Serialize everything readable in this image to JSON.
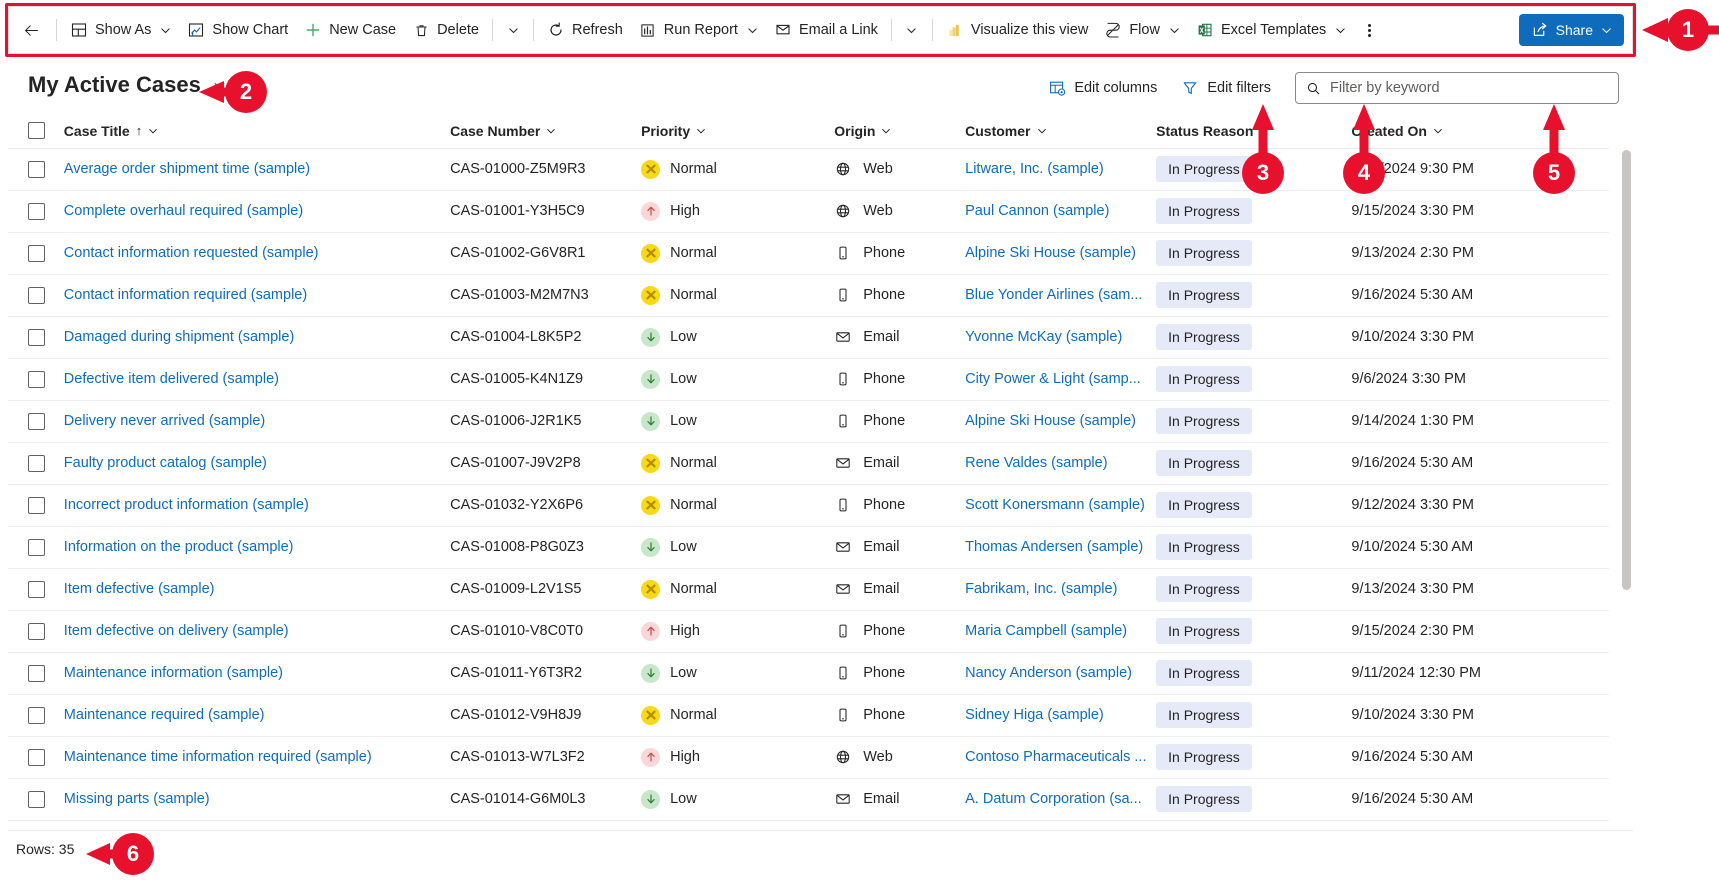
{
  "command_bar": {
    "back_label": "Back",
    "items": [
      {
        "id": "show-as",
        "label": "Show As",
        "icon": "show-as-icon",
        "caret": true
      },
      {
        "id": "show-chart",
        "label": "Show Chart",
        "icon": "chart-icon",
        "caret": false
      },
      {
        "id": "new-case",
        "label": "New Case",
        "icon": "plus-icon",
        "caret": false
      },
      {
        "id": "delete",
        "label": "Delete",
        "icon": "trash-icon",
        "caret": false
      },
      {
        "id": "delete-more",
        "label": "",
        "icon": "chevron-down-icon",
        "caret": true
      },
      {
        "id": "refresh",
        "label": "Refresh",
        "icon": "refresh-icon",
        "caret": false
      },
      {
        "id": "run-report",
        "label": "Run Report",
        "icon": "report-icon",
        "caret": true
      },
      {
        "id": "email-a-link",
        "label": "Email a Link",
        "icon": "email-link-icon",
        "caret": false
      },
      {
        "id": "email-more",
        "label": "",
        "icon": "chevron-down-icon",
        "caret": true
      },
      {
        "id": "visualize-this-view",
        "label": "Visualize this view",
        "icon": "powerbi-icon",
        "caret": false
      },
      {
        "id": "flow",
        "label": "Flow",
        "icon": "flow-icon",
        "caret": true
      },
      {
        "id": "excel-templates",
        "label": "Excel Templates",
        "icon": "excel-icon",
        "caret": true
      }
    ],
    "overflow_label": "More commands",
    "share": {
      "label": "Share",
      "icon": "share-icon",
      "caret": true,
      "color": "#0f6cbd"
    }
  },
  "view": {
    "title": "My Active Cases",
    "title_caret": "chevron-down-icon"
  },
  "grid_actions": {
    "edit_columns": {
      "label": "Edit columns",
      "icon": "edit-columns-icon"
    },
    "edit_filters": {
      "label": "Edit filters",
      "icon": "filter-icon"
    },
    "search": {
      "placeholder": "Filter by keyword",
      "value": "",
      "icon": "search-icon"
    }
  },
  "table": {
    "select_all_label": "Select all rows",
    "columns": [
      {
        "key": "title",
        "label": "Case Title",
        "sorted": "asc",
        "sort_glyph": "↑"
      },
      {
        "key": "casenumber",
        "label": "Case Number"
      },
      {
        "key": "priority",
        "label": "Priority"
      },
      {
        "key": "origin",
        "label": "Origin"
      },
      {
        "key": "customer",
        "label": "Customer"
      },
      {
        "key": "status",
        "label": "Status Reason"
      },
      {
        "key": "created",
        "label": "Created On"
      }
    ],
    "rows": [
      {
        "title": "Average order shipment time (sample)",
        "casenumber": "CAS-01000-Z5M9R3",
        "priority": "Normal",
        "priority_level": "normal",
        "origin": "Web",
        "origin_icon": "globe-icon",
        "customer": "Litware, Inc. (sample)",
        "status": "In Progress",
        "created": "9/15/2024 9:30 PM"
      },
      {
        "title": "Complete overhaul required (sample)",
        "casenumber": "CAS-01001-Y3H5C9",
        "priority": "High",
        "priority_level": "high",
        "origin": "Web",
        "origin_icon": "globe-icon",
        "customer": "Paul Cannon (sample)",
        "status": "In Progress",
        "created": "9/15/2024 3:30 PM"
      },
      {
        "title": "Contact information requested (sample)",
        "casenumber": "CAS-01002-G6V8R1",
        "priority": "Normal",
        "priority_level": "normal",
        "origin": "Phone",
        "origin_icon": "phone-icon",
        "customer": "Alpine Ski House (sample)",
        "status": "In Progress",
        "created": "9/13/2024 2:30 PM"
      },
      {
        "title": "Contact information required (sample)",
        "casenumber": "CAS-01003-M2M7N3",
        "priority": "Normal",
        "priority_level": "normal",
        "origin": "Phone",
        "origin_icon": "phone-icon",
        "customer": "Blue Yonder Airlines (sam...",
        "status": "In Progress",
        "created": "9/16/2024 5:30 AM"
      },
      {
        "title": "Damaged during shipment (sample)",
        "casenumber": "CAS-01004-L8K5P2",
        "priority": "Low",
        "priority_level": "low",
        "origin": "Email",
        "origin_icon": "envelope-icon",
        "customer": "Yvonne McKay (sample)",
        "status": "In Progress",
        "created": "9/10/2024 3:30 PM"
      },
      {
        "title": "Defective item delivered (sample)",
        "casenumber": "CAS-01005-K4N1Z9",
        "priority": "Low",
        "priority_level": "low",
        "origin": "Phone",
        "origin_icon": "phone-icon",
        "customer": "City Power & Light (samp...",
        "status": "In Progress",
        "created": "9/6/2024 3:30 PM"
      },
      {
        "title": "Delivery never arrived (sample)",
        "casenumber": "CAS-01006-J2R1K5",
        "priority": "Low",
        "priority_level": "low",
        "origin": "Phone",
        "origin_icon": "phone-icon",
        "customer": "Alpine Ski House (sample)",
        "status": "In Progress",
        "created": "9/14/2024 1:30 PM"
      },
      {
        "title": "Faulty product catalog (sample)",
        "casenumber": "CAS-01007-J9V2P8",
        "priority": "Normal",
        "priority_level": "normal",
        "origin": "Email",
        "origin_icon": "envelope-icon",
        "customer": "Rene Valdes (sample)",
        "status": "In Progress",
        "created": "9/16/2024 5:30 AM"
      },
      {
        "title": "Incorrect product information (sample)",
        "casenumber": "CAS-01032-Y2X6P6",
        "priority": "Normal",
        "priority_level": "normal",
        "origin": "Phone",
        "origin_icon": "phone-icon",
        "customer": "Scott Konersmann (sample)",
        "status": "In Progress",
        "created": "9/12/2024 3:30 PM"
      },
      {
        "title": "Information on the product (sample)",
        "casenumber": "CAS-01008-P8G0Z3",
        "priority": "Low",
        "priority_level": "low",
        "origin": "Email",
        "origin_icon": "envelope-icon",
        "customer": "Thomas Andersen (sample)",
        "status": "In Progress",
        "created": "9/10/2024 5:30 AM"
      },
      {
        "title": "Item defective (sample)",
        "casenumber": "CAS-01009-L2V1S5",
        "priority": "Normal",
        "priority_level": "normal",
        "origin": "Email",
        "origin_icon": "envelope-icon",
        "customer": "Fabrikam, Inc. (sample)",
        "status": "In Progress",
        "created": "9/13/2024 3:30 PM"
      },
      {
        "title": "Item defective on delivery (sample)",
        "casenumber": "CAS-01010-V8C0T0",
        "priority": "High",
        "priority_level": "high",
        "origin": "Phone",
        "origin_icon": "phone-icon",
        "customer": "Maria Campbell (sample)",
        "status": "In Progress",
        "created": "9/15/2024 2:30 PM"
      },
      {
        "title": "Maintenance information (sample)",
        "casenumber": "CAS-01011-Y6T3R2",
        "priority": "Low",
        "priority_level": "low",
        "origin": "Phone",
        "origin_icon": "phone-icon",
        "customer": "Nancy Anderson (sample)",
        "status": "In Progress",
        "created": "9/11/2024 12:30 PM"
      },
      {
        "title": "Maintenance required (sample)",
        "casenumber": "CAS-01012-V9H8J9",
        "priority": "Normal",
        "priority_level": "normal",
        "origin": "Phone",
        "origin_icon": "phone-icon",
        "customer": "Sidney Higa (sample)",
        "status": "In Progress",
        "created": "9/10/2024 3:30 PM"
      },
      {
        "title": "Maintenance time information required (sample)",
        "casenumber": "CAS-01013-W7L3F2",
        "priority": "High",
        "priority_level": "high",
        "origin": "Web",
        "origin_icon": "globe-icon",
        "customer": "Contoso Pharmaceuticals ...",
        "status": "In Progress",
        "created": "9/16/2024 5:30 AM"
      },
      {
        "title": "Missing parts (sample)",
        "casenumber": "CAS-01014-G6M0L3",
        "priority": "Low",
        "priority_level": "low",
        "origin": "Email",
        "origin_icon": "envelope-icon",
        "customer": "A. Datum Corporation (sa...",
        "status": "In Progress",
        "created": "9/16/2024 5:30 AM"
      }
    ]
  },
  "footer": {
    "rows_label": "Rows: 35"
  },
  "annotations": {
    "color": "#e8112d",
    "callouts": [
      {
        "number": "1",
        "target": "command-bar"
      },
      {
        "number": "2",
        "target": "view-selector"
      },
      {
        "number": "3",
        "target": "edit-columns"
      },
      {
        "number": "4",
        "target": "edit-filters"
      },
      {
        "number": "5",
        "target": "filter-by-keyword"
      },
      {
        "number": "6",
        "target": "row-count"
      }
    ]
  }
}
